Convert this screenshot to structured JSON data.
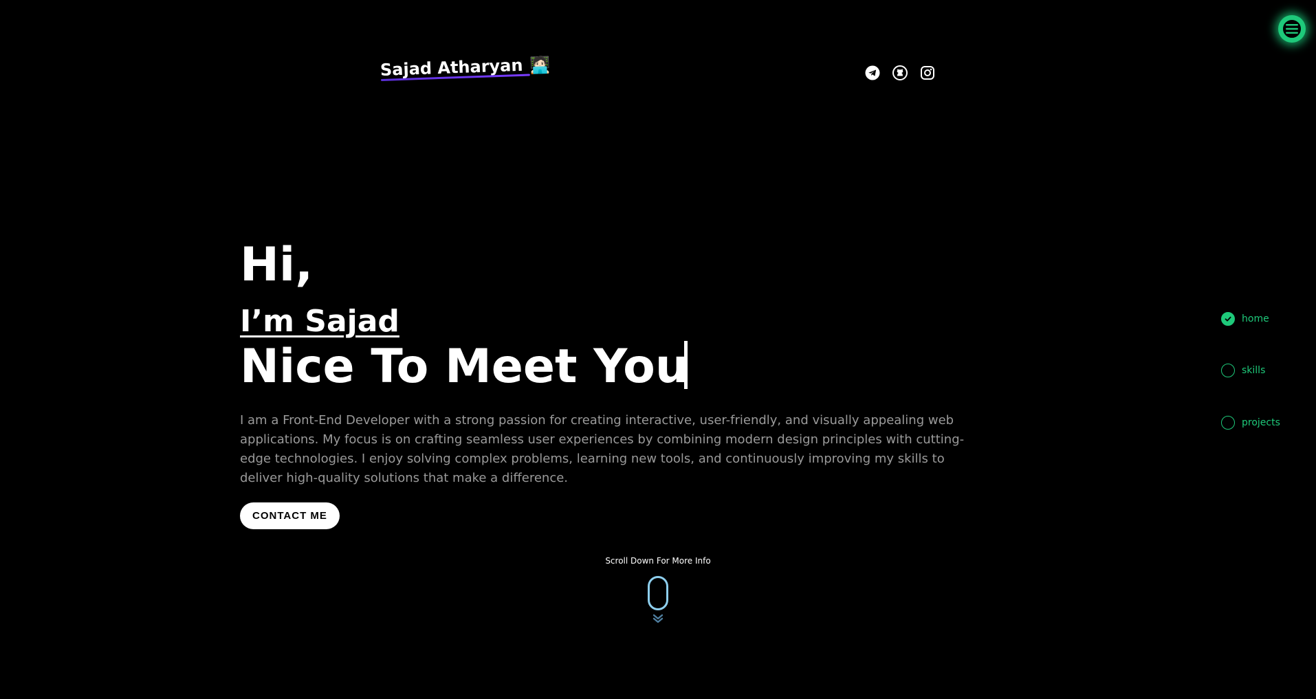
{
  "header": {
    "brand_name": "Sajad Atharyan",
    "brand_emoji": "🧑🏻‍💻",
    "socials": [
      {
        "icon": "telegram-icon"
      },
      {
        "icon": "github-icon"
      },
      {
        "icon": "instagram-icon"
      }
    ]
  },
  "menu": {
    "icon": "hamburger-menu-icon"
  },
  "hero": {
    "greeting": "Hi,",
    "intro": "I’m Sajad",
    "headline": "Nice To Meet You",
    "bio": "I am a Front-End Developer with a strong passion for creating interactive, user-friendly, and visually appealing web applications. My focus is on crafting seamless user experiences by combining modern design principles with cutting-edge technologies. I enjoy solving complex problems, learning new tools, and continuously improving my skills to deliver high-quality solutions that make a difference.",
    "cta_label": "CONTACT ME"
  },
  "scroll_hint": {
    "text": "Scroll Down For More Info"
  },
  "side_nav": {
    "items": [
      {
        "label": "home",
        "active": true
      },
      {
        "label": "skills",
        "active": false
      },
      {
        "label": "projects",
        "active": false
      }
    ]
  },
  "colors": {
    "background": "#000000",
    "accent_green": "#1ec97a",
    "brand_underline": "#6b34f0",
    "mouse_outline": "#8ecfee",
    "bio_text": "#9a9a9a"
  }
}
